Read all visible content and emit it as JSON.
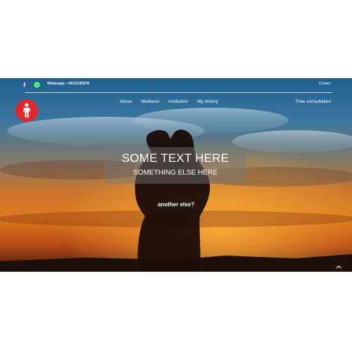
{
  "topbar": {
    "social": [
      {
        "icon": "facebook-icon",
        "color": "#3b5998"
      },
      {
        "icon": "whatsapp-icon",
        "color": "#25d366"
      }
    ],
    "whatsapp_text": "Whatsapp: +4012345678",
    "contact_label": "Contact"
  },
  "header": {
    "logo_icon": "person-icon",
    "logo_color": "#e3262a",
    "nav": [
      "About",
      "Wellness",
      "Institution",
      "My history"
    ],
    "consult_label": "Free consultation"
  },
  "hero": {
    "headline": "SOME TEXT HERE",
    "subheadline": "SOMETHING ELSE HERE",
    "cta": "another else?"
  },
  "footer": {
    "scroll_icon": "chevron-up-icon"
  }
}
